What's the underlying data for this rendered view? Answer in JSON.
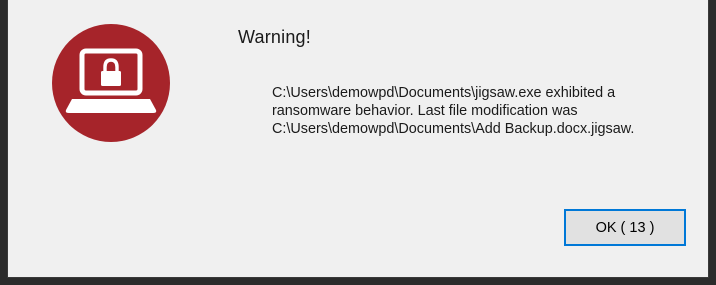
{
  "dialog": {
    "title": "Warning!",
    "message_lines": [
      "C:\\Users\\demowpd\\Documents\\jigsaw.exe exhibited a",
      "ransomware  behavior. Last file modification was",
      "C:\\Users\\demowpd\\Documents\\Add Backup.docx.jigsaw."
    ],
    "ok_button_label": "OK ( 13 )",
    "icon": "locked-laptop-icon"
  },
  "colors": {
    "icon_circle": "#a6242a",
    "button_focus_border": "#0078d7",
    "dialog_background": "#f0f0f0",
    "outer_background": "#2b2b2b"
  }
}
